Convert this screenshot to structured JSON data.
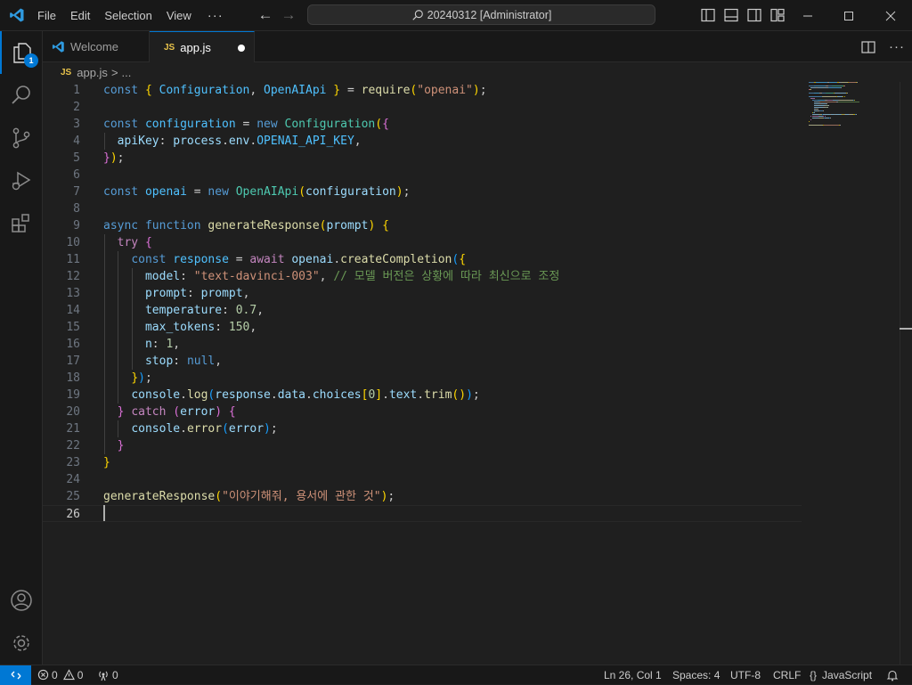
{
  "titlebar": {
    "menu": [
      "File",
      "Edit",
      "Selection",
      "View"
    ],
    "more": "···",
    "search_text": "20240312 [Administrator]"
  },
  "activity": {
    "explorer_badge": "1"
  },
  "tabs": [
    {
      "label": "Welcome",
      "icon": "vscode-icon",
      "active": false
    },
    {
      "label": "app.js",
      "icon": "js-file-icon",
      "prefix": "JS",
      "active": true,
      "dirty": true
    }
  ],
  "breadcrumb": {
    "prefix": "JS",
    "file": "app.js",
    "sep": ">",
    "tail": "..."
  },
  "editor": {
    "lines": [
      [
        [
          "kw",
          "const "
        ],
        [
          "b1",
          "{ "
        ],
        [
          "const",
          "Configuration"
        ],
        [
          "p",
          ", "
        ],
        [
          "const",
          "OpenAIApi"
        ],
        [
          "b1",
          " }"
        ],
        [
          "p",
          " = "
        ],
        [
          "fn",
          "require"
        ],
        [
          "b1",
          "("
        ],
        [
          "str",
          "\"openai\""
        ],
        [
          "b1",
          ")"
        ],
        [
          "p",
          ";"
        ]
      ],
      [],
      [
        [
          "kw",
          "const "
        ],
        [
          "const",
          "configuration"
        ],
        [
          "p",
          " = "
        ],
        [
          "kw",
          "new "
        ],
        [
          "cls",
          "Configuration"
        ],
        [
          "b1",
          "("
        ],
        [
          "b2",
          "{"
        ]
      ],
      [
        [
          "p",
          "  "
        ],
        [
          "var",
          "apiKey"
        ],
        [
          "p",
          ": "
        ],
        [
          "var",
          "process"
        ],
        [
          "p",
          "."
        ],
        [
          "var",
          "env"
        ],
        [
          "p",
          "."
        ],
        [
          "const",
          "OPENAI_API_KEY"
        ],
        [
          "p",
          ","
        ]
      ],
      [
        [
          "b2",
          "}"
        ],
        [
          "b1",
          ")"
        ],
        [
          "p",
          ";"
        ]
      ],
      [],
      [
        [
          "kw",
          "const "
        ],
        [
          "const",
          "openai"
        ],
        [
          "p",
          " = "
        ],
        [
          "kw",
          "new "
        ],
        [
          "cls",
          "OpenAIApi"
        ],
        [
          "b1",
          "("
        ],
        [
          "var",
          "configuration"
        ],
        [
          "b1",
          ")"
        ],
        [
          "p",
          ";"
        ]
      ],
      [],
      [
        [
          "kw",
          "async "
        ],
        [
          "kw",
          "function "
        ],
        [
          "fn",
          "generateResponse"
        ],
        [
          "b1",
          "("
        ],
        [
          "var",
          "prompt"
        ],
        [
          "b1",
          ")"
        ],
        [
          "p",
          " "
        ],
        [
          "b1",
          "{"
        ]
      ],
      [
        [
          "p",
          "  "
        ],
        [
          "ctl",
          "try "
        ],
        [
          "b2",
          "{"
        ]
      ],
      [
        [
          "p",
          "    "
        ],
        [
          "kw",
          "const "
        ],
        [
          "const",
          "response"
        ],
        [
          "p",
          " = "
        ],
        [
          "ctl",
          "await "
        ],
        [
          "var",
          "openai"
        ],
        [
          "p",
          "."
        ],
        [
          "fn",
          "createCompletion"
        ],
        [
          "b3",
          "("
        ],
        [
          "b1",
          "{"
        ]
      ],
      [
        [
          "p",
          "      "
        ],
        [
          "var",
          "model"
        ],
        [
          "p",
          ": "
        ],
        [
          "str",
          "\"text-davinci-003\""
        ],
        [
          "p",
          ", "
        ],
        [
          "cmt",
          "// 모델 버전은 상황에 따라 최신으로 조정"
        ]
      ],
      [
        [
          "p",
          "      "
        ],
        [
          "var",
          "prompt"
        ],
        [
          "p",
          ": "
        ],
        [
          "var",
          "prompt"
        ],
        [
          "p",
          ","
        ]
      ],
      [
        [
          "p",
          "      "
        ],
        [
          "var",
          "temperature"
        ],
        [
          "p",
          ": "
        ],
        [
          "num",
          "0.7"
        ],
        [
          "p",
          ","
        ]
      ],
      [
        [
          "p",
          "      "
        ],
        [
          "var",
          "max_tokens"
        ],
        [
          "p",
          ": "
        ],
        [
          "num",
          "150"
        ],
        [
          "p",
          ","
        ]
      ],
      [
        [
          "p",
          "      "
        ],
        [
          "var",
          "n"
        ],
        [
          "p",
          ": "
        ],
        [
          "num",
          "1"
        ],
        [
          "p",
          ","
        ]
      ],
      [
        [
          "p",
          "      "
        ],
        [
          "var",
          "stop"
        ],
        [
          "p",
          ": "
        ],
        [
          "kw",
          "null"
        ],
        [
          "p",
          ","
        ]
      ],
      [
        [
          "p",
          "    "
        ],
        [
          "b1",
          "}"
        ],
        [
          "b3",
          ")"
        ],
        [
          "p",
          ";"
        ]
      ],
      [
        [
          "p",
          "    "
        ],
        [
          "var",
          "console"
        ],
        [
          "p",
          "."
        ],
        [
          "fn",
          "log"
        ],
        [
          "b3",
          "("
        ],
        [
          "var",
          "response"
        ],
        [
          "p",
          "."
        ],
        [
          "var",
          "data"
        ],
        [
          "p",
          "."
        ],
        [
          "var",
          "choices"
        ],
        [
          "b1",
          "["
        ],
        [
          "num",
          "0"
        ],
        [
          "b1",
          "]"
        ],
        [
          "p",
          "."
        ],
        [
          "var",
          "text"
        ],
        [
          "p",
          "."
        ],
        [
          "fn",
          "trim"
        ],
        [
          "b1",
          "()"
        ],
        [
          "b3",
          ")"
        ],
        [
          "p",
          ";"
        ]
      ],
      [
        [
          "p",
          "  "
        ],
        [
          "b2",
          "}"
        ],
        [
          "p",
          " "
        ],
        [
          "ctl",
          "catch "
        ],
        [
          "b2",
          "("
        ],
        [
          "var",
          "error"
        ],
        [
          "b2",
          ")"
        ],
        [
          "p",
          " "
        ],
        [
          "b2",
          "{"
        ]
      ],
      [
        [
          "p",
          "    "
        ],
        [
          "var",
          "console"
        ],
        [
          "p",
          "."
        ],
        [
          "fn",
          "error"
        ],
        [
          "b3",
          "("
        ],
        [
          "var",
          "error"
        ],
        [
          "b3",
          ")"
        ],
        [
          "p",
          ";"
        ]
      ],
      [
        [
          "p",
          "  "
        ],
        [
          "b2",
          "}"
        ]
      ],
      [
        [
          "b1",
          "}"
        ]
      ],
      [],
      [
        [
          "fn",
          "generateResponse"
        ],
        [
          "b1",
          "("
        ],
        [
          "str",
          "\"이야기해줘, 용서에 관한 것\""
        ],
        [
          "b1",
          ")"
        ],
        [
          "p",
          ";"
        ]
      ],
      []
    ],
    "current_line": 26
  },
  "status": {
    "errors": "0",
    "warnings": "0",
    "ports": "0",
    "cursor": "Ln 26, Col 1",
    "spaces": "Spaces: 4",
    "encoding": "UTF-8",
    "eol": "CRLF",
    "language_prefix": "{}",
    "language": "JavaScript"
  },
  "colors": {
    "accent": "#0078d4",
    "background": "#1f1f1f",
    "chrome": "#181818"
  }
}
